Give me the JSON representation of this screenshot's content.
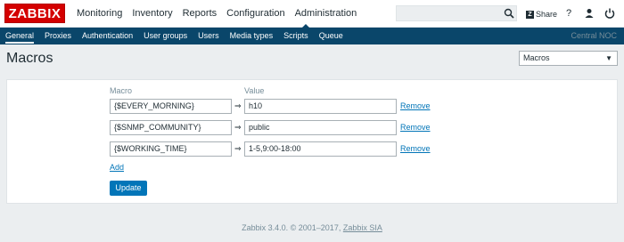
{
  "header": {
    "logo": "ZABBIX",
    "nav": [
      "Monitoring",
      "Inventory",
      "Reports",
      "Configuration",
      "Administration"
    ],
    "share": "Share",
    "help": "?",
    "user": "user",
    "logout": "logout"
  },
  "subnav": {
    "items": [
      "General",
      "Proxies",
      "Authentication",
      "User groups",
      "Users",
      "Media types",
      "Scripts",
      "Queue"
    ],
    "server": "Central NOC"
  },
  "page": {
    "title": "Macros",
    "select": "Macros"
  },
  "form": {
    "col_macro": "Macro",
    "col_value": "Value",
    "rows": [
      {
        "macro": "{$EVERY_MORNING}",
        "arrow": "⇒",
        "value": "h10",
        "remove": "Remove"
      },
      {
        "macro": "{$SNMP_COMMUNITY}",
        "arrow": "⇒",
        "value": "public",
        "remove": "Remove"
      },
      {
        "macro": "{$WORKING_TIME}",
        "arrow": "⇒",
        "value": "1-5,9:00-18:00",
        "remove": "Remove"
      }
    ],
    "add": "Add",
    "update": "Update"
  },
  "footer": {
    "text": "Zabbix 3.4.0. © 2001–2017,",
    "link": "Zabbix SIA"
  }
}
